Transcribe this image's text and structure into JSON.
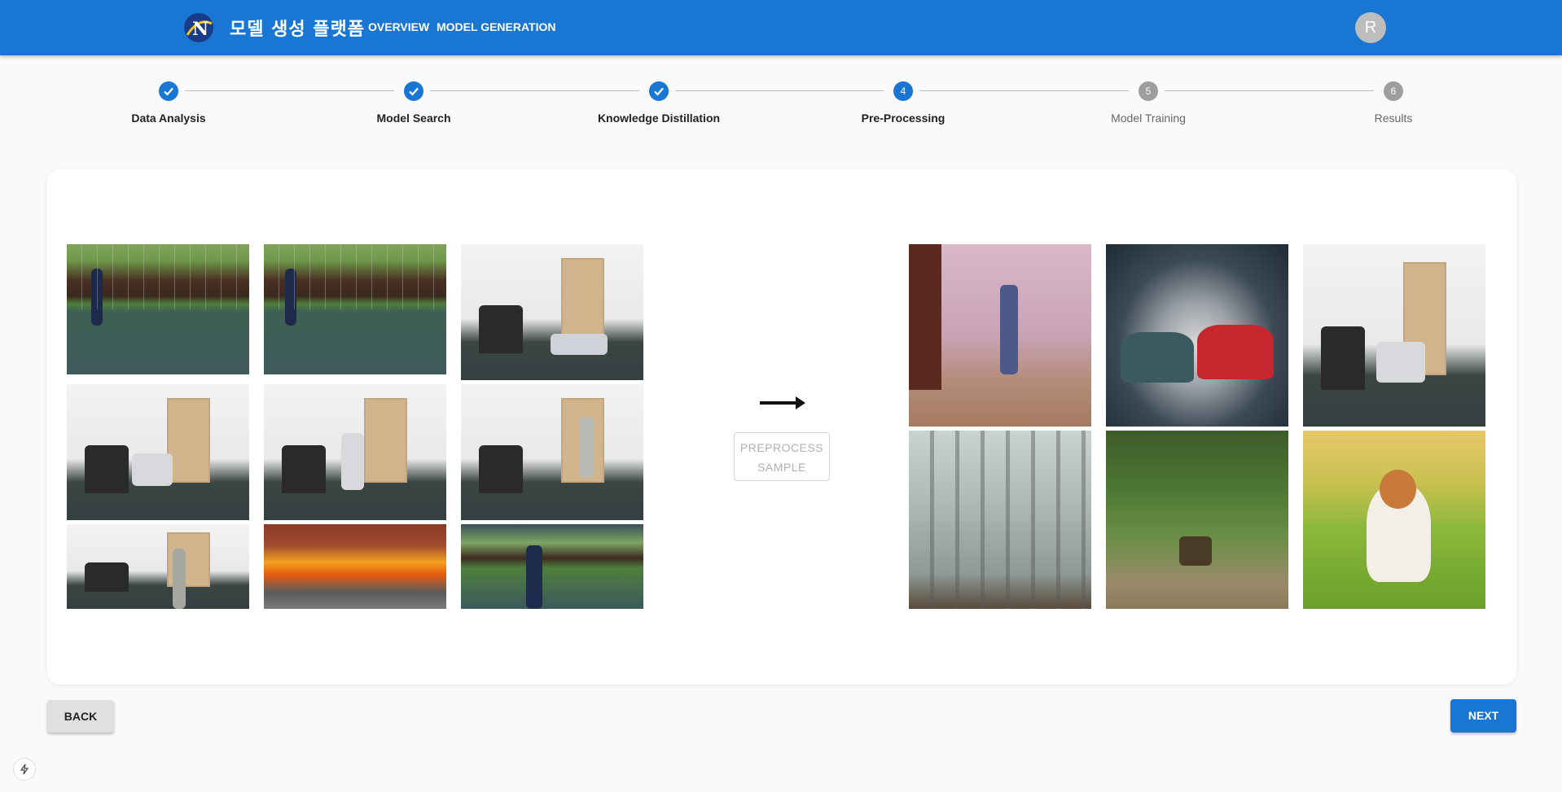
{
  "header": {
    "brand": "모델 생성 플랫폼",
    "nav": {
      "overview": "OVERVIEW",
      "model_generation": "MODEL GENERATION"
    },
    "avatar_initial": "R",
    "colors": {
      "appbar": "#1976d2"
    }
  },
  "stepper": {
    "steps": [
      {
        "label": "Data Analysis",
        "state": "done",
        "index": "1"
      },
      {
        "label": "Model Search",
        "state": "done",
        "index": "2"
      },
      {
        "label": "Knowledge Distillation",
        "state": "done",
        "index": "3"
      },
      {
        "label": "Pre-Processing",
        "state": "active",
        "index": "4"
      },
      {
        "label": "Model Training",
        "state": "todo",
        "index": "5"
      },
      {
        "label": "Results",
        "state": "todo",
        "index": "6"
      }
    ]
  },
  "input_samples": {
    "images": [
      {
        "scene": "tennis-court-walking"
      },
      {
        "scene": "tennis-court-walking"
      },
      {
        "scene": "office-person-fallen"
      },
      {
        "scene": "office-person-crawling"
      },
      {
        "scene": "office-person-crouching"
      },
      {
        "scene": "office-person-standing"
      },
      {
        "scene": "office-person-standing"
      },
      {
        "scene": "car-on-fire"
      },
      {
        "scene": "tennis-court-person"
      }
    ]
  },
  "preprocess": {
    "arrow_icon": "arrow-right-icon",
    "button_label_line1": "PREPROCESS",
    "button_label_line2": "SAMPLE",
    "button_enabled": false
  },
  "output_samples": {
    "images": [
      {
        "scene": "bedroom-person-standing"
      },
      {
        "scene": "car-crash"
      },
      {
        "scene": "office-person-crawling"
      },
      {
        "scene": "broken-window"
      },
      {
        "scene": "ducks-on-grass"
      },
      {
        "scene": "dog-barking-on-grass"
      }
    ]
  },
  "footer": {
    "back_label": "BACK",
    "next_label": "NEXT"
  }
}
